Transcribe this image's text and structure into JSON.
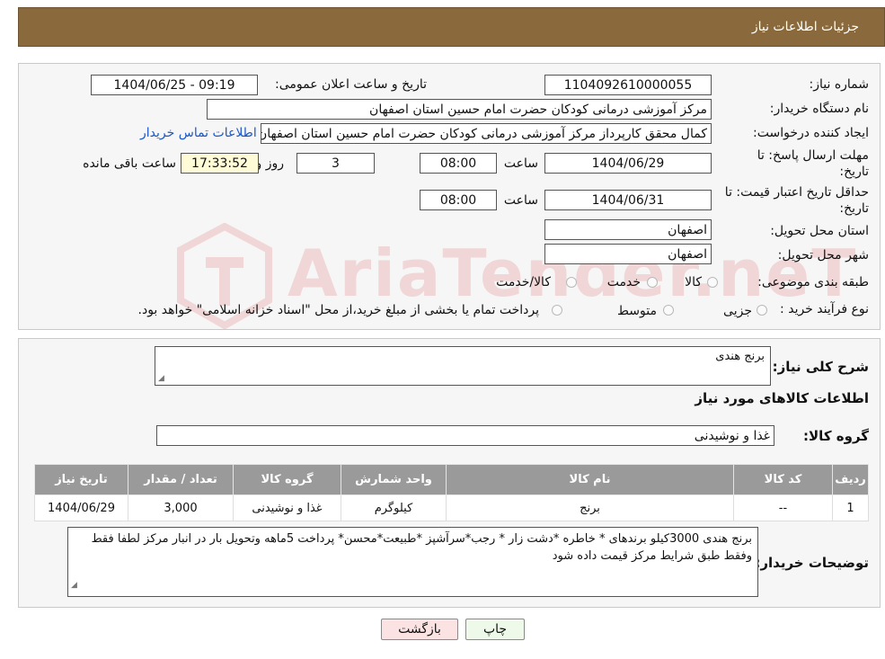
{
  "header": {
    "title": "جزئیات اطلاعات نیاز"
  },
  "watermark": {
    "text": "AriaTender.neT"
  },
  "form": {
    "need_number": {
      "label": "شماره نیاز:",
      "value": "1104092610000055"
    },
    "announce": {
      "label": "تاریخ و ساعت اعلان عمومی:",
      "value": "1404/06/25 - 09:19"
    },
    "buyer_org": {
      "label": "نام دستگاه خریدار:",
      "value": "مرکز آموزشی درمانی کودکان حضرت امام حسین استان اصفهان"
    },
    "creator": {
      "label": "ایجاد کننده درخواست:",
      "value": "کمال محقق کارپرداز مرکز آموزشی درمانی کودکان حضرت امام حسین استان اصفهان",
      "contact_link": "اطلاعات تماس خریدار"
    },
    "deadline": {
      "label_line1": "مهلت ارسال پاسخ: تا",
      "label_line2": "تاریخ:",
      "date": "1404/06/29",
      "time_label": "ساعت",
      "time": "08:00",
      "days": "3",
      "days_label": "روز و",
      "remaining": "17:33:52",
      "remaining_label": "ساعت باقی مانده"
    },
    "validity": {
      "label_line1": "حداقل تاریخ اعتبار قیمت: تا",
      "label_line2": "تاریخ:",
      "date": "1404/06/31",
      "time_label": "ساعت",
      "time": "08:00"
    },
    "province": {
      "label": "استان محل تحویل:",
      "value": "اصفهان"
    },
    "city": {
      "label": "شهر محل تحویل:",
      "value": "اصفهان"
    },
    "category": {
      "label": "طبقه بندی موضوعی:",
      "options": [
        "کالا",
        "خدمت",
        "کالا/خدمت"
      ]
    },
    "process": {
      "label": "نوع فرآیند خرید :",
      "options": [
        "جزیی",
        "متوسط"
      ],
      "note": "پرداخت تمام یا بخشی از مبلغ خرید،از محل \"اسناد خزانه اسلامی\" خواهد بود."
    }
  },
  "details": {
    "summary_label": "شرح کلی نیاز:",
    "summary_value": "برنج هندی",
    "goods_info_title": "اطلاعات کالاهای مورد نیاز",
    "goods_group_label": "گروه کالا:",
    "goods_group_value": "غذا و نوشیدنی",
    "table": {
      "headers": [
        "ردیف",
        "کد کالا",
        "نام کالا",
        "واحد شمارش",
        "گروه کالا",
        "تعداد / مقدار",
        "تاریخ نیاز"
      ],
      "rows": [
        [
          "1",
          "--",
          "برنج",
          "کیلوگرم",
          "غذا و نوشیدنی",
          "3,000",
          "1404/06/29"
        ]
      ]
    },
    "buyer_notes_label": "توضیحات خریدار:",
    "buyer_notes_value": "برنج هندی 3000کیلو برندهای * خاطره *دشت زار * رجب*سرآشپز *طبیعت*محسن* پرداخت 5ماهه وتحویل بار در انبار مرکز لطفا فقط وفقط طبق شرایط مرکز قیمت داده شود"
  },
  "buttons": {
    "print": "چاپ",
    "back": "بازگشت"
  },
  "colors": {
    "header_bg": "#8a6a3c",
    "link": "#1a56c8",
    "table_header": "#9a9a9a"
  }
}
